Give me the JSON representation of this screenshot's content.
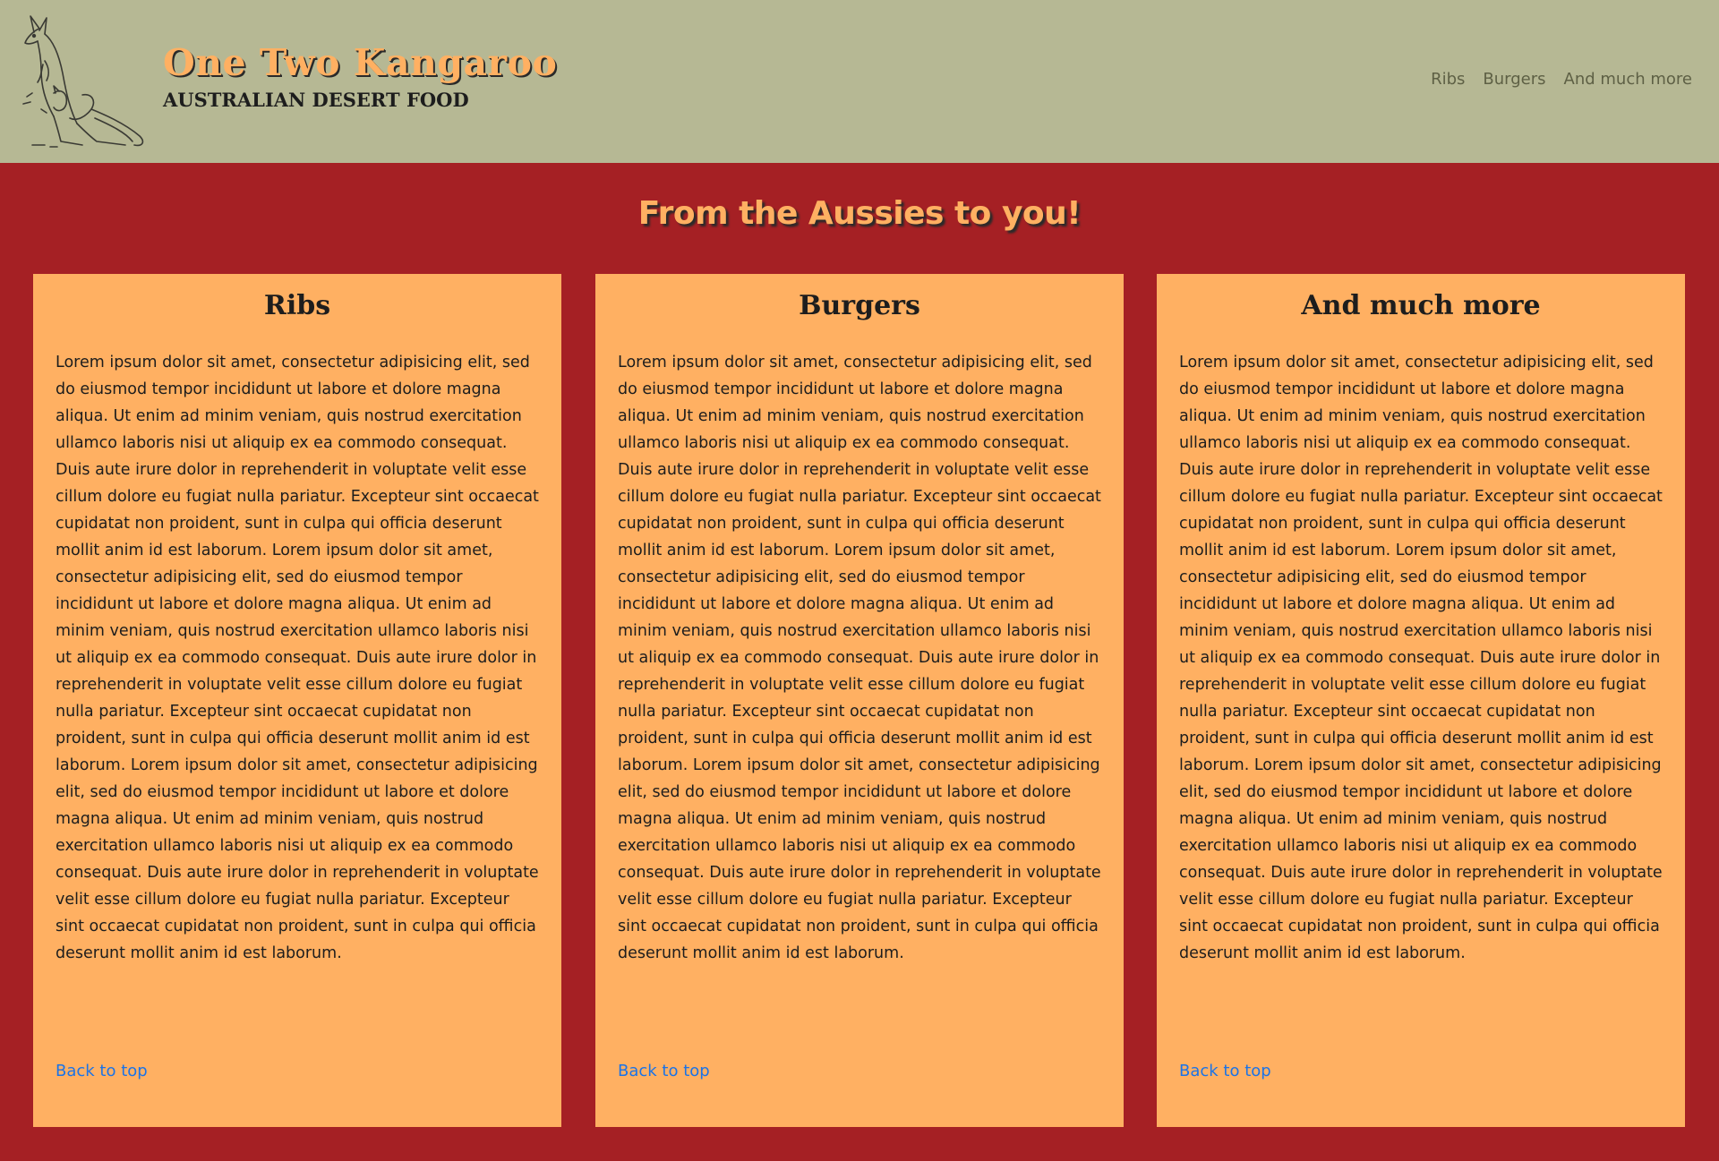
{
  "header": {
    "brand_title": "One Two Kangaroo",
    "brand_subtitle": "AUSTRALIAN DESERT FOOD",
    "nav": [
      "Ribs",
      "Burgers",
      "And much more"
    ]
  },
  "hero": {
    "title": "From the Aussies to you!"
  },
  "cards": [
    {
      "title": "Ribs",
      "body": "Lorem ipsum dolor sit amet, consectetur adipisicing elit, sed do eiusmod tempor incididunt ut labore et dolore magna aliqua. Ut enim ad minim veniam, quis nostrud exercitation ullamco laboris nisi ut aliquip ex ea commodo consequat. Duis aute irure dolor in reprehenderit in voluptate velit esse cillum dolore eu fugiat nulla pariatur. Excepteur sint occaecat cupidatat non proident, sunt in culpa qui officia deserunt mollit anim id est laborum. Lorem ipsum dolor sit amet, consectetur adipisicing elit, sed do eiusmod tempor incididunt ut labore et dolore magna aliqua. Ut enim ad minim veniam, quis nostrud exercitation ullamco laboris nisi ut aliquip ex ea commodo consequat. Duis aute irure dolor in reprehenderit in voluptate velit esse cillum dolore eu fugiat nulla pariatur. Excepteur sint occaecat cupidatat non proident, sunt in culpa qui officia deserunt mollit anim id est laborum. Lorem ipsum dolor sit amet, consectetur adipisicing elit, sed do eiusmod tempor incididunt ut labore et dolore magna aliqua. Ut enim ad minim veniam, quis nostrud exercitation ullamco laboris nisi ut aliquip ex ea commodo consequat. Duis aute irure dolor in reprehenderit in voluptate velit esse cillum dolore eu fugiat nulla pariatur. Excepteur sint occaecat cupidatat non proident, sunt in culpa qui officia deserunt mollit anim id est laborum.",
      "back_link": "Back to top"
    },
    {
      "title": "Burgers",
      "body": "Lorem ipsum dolor sit amet, consectetur adipisicing elit, sed do eiusmod tempor incididunt ut labore et dolore magna aliqua. Ut enim ad minim veniam, quis nostrud exercitation ullamco laboris nisi ut aliquip ex ea commodo consequat. Duis aute irure dolor in reprehenderit in voluptate velit esse cillum dolore eu fugiat nulla pariatur. Excepteur sint occaecat cupidatat non proident, sunt in culpa qui officia deserunt mollit anim id est laborum. Lorem ipsum dolor sit amet, consectetur adipisicing elit, sed do eiusmod tempor incididunt ut labore et dolore magna aliqua. Ut enim ad minim veniam, quis nostrud exercitation ullamco laboris nisi ut aliquip ex ea commodo consequat. Duis aute irure dolor in reprehenderit in voluptate velit esse cillum dolore eu fugiat nulla pariatur. Excepteur sint occaecat cupidatat non proident, sunt in culpa qui officia deserunt mollit anim id est laborum. Lorem ipsum dolor sit amet, consectetur adipisicing elit, sed do eiusmod tempor incididunt ut labore et dolore magna aliqua. Ut enim ad minim veniam, quis nostrud exercitation ullamco laboris nisi ut aliquip ex ea commodo consequat. Duis aute irure dolor in reprehenderit in voluptate velit esse cillum dolore eu fugiat nulla pariatur. Excepteur sint occaecat cupidatat non proident, sunt in culpa qui officia deserunt mollit anim id est laborum.",
      "back_link": "Back to top"
    },
    {
      "title": "And much more",
      "body": "Lorem ipsum dolor sit amet, consectetur adipisicing elit, sed do eiusmod tempor incididunt ut labore et dolore magna aliqua. Ut enim ad minim veniam, quis nostrud exercitation ullamco laboris nisi ut aliquip ex ea commodo consequat. Duis aute irure dolor in reprehenderit in voluptate velit esse cillum dolore eu fugiat nulla pariatur. Excepteur sint occaecat cupidatat non proident, sunt in culpa qui officia deserunt mollit anim id est laborum. Lorem ipsum dolor sit amet, consectetur adipisicing elit, sed do eiusmod tempor incididunt ut labore et dolore magna aliqua. Ut enim ad minim veniam, quis nostrud exercitation ullamco laboris nisi ut aliquip ex ea commodo consequat. Duis aute irure dolor in reprehenderit in voluptate velit esse cillum dolore eu fugiat nulla pariatur. Excepteur sint occaecat cupidatat non proident, sunt in culpa qui officia deserunt mollit anim id est laborum. Lorem ipsum dolor sit amet, consectetur adipisicing elit, sed do eiusmod tempor incididunt ut labore et dolore magna aliqua. Ut enim ad minim veniam, quis nostrud exercitation ullamco laboris nisi ut aliquip ex ea commodo consequat. Duis aute irure dolor in reprehenderit in voluptate velit esse cillum dolore eu fugiat nulla pariatur. Excepteur sint occaecat cupidatat non proident, sunt in culpa qui officia deserunt mollit anim id est laborum.",
      "back_link": "Back to top"
    }
  ],
  "colors": {
    "header_bg": "#b6b894",
    "page_bg": "#a52024",
    "card_bg": "#ffb062",
    "accent": "#ffb062",
    "link": "#1a73e8"
  }
}
